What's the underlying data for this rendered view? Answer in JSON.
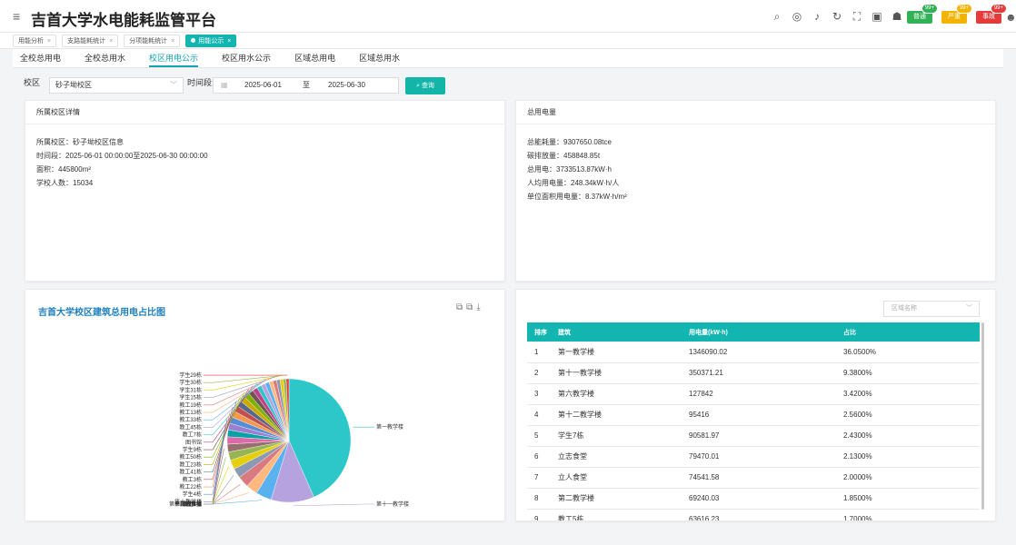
{
  "header": {
    "title": "吉首大学水电能耗监管平台",
    "alarms": [
      {
        "label": "普通",
        "count": "99+",
        "color": "#33b157"
      },
      {
        "label": "严重",
        "count": "99+",
        "color": "#f2b400"
      },
      {
        "label": "事故",
        "count": "99+",
        "color": "#e33b3b"
      }
    ]
  },
  "tabs": [
    {
      "label": "用能分析"
    },
    {
      "label": "支路能耗统计"
    },
    {
      "label": "分项能耗统计"
    },
    {
      "label": "用能公示",
      "active": true
    }
  ],
  "subtabs": [
    {
      "label": "全校总用电"
    },
    {
      "label": "全校总用水"
    },
    {
      "label": "校区用电公示",
      "active": true
    },
    {
      "label": "校区用水公示"
    },
    {
      "label": "区域总用电"
    },
    {
      "label": "区域总用水"
    }
  ],
  "filter": {
    "campus_label": "校区",
    "campus_value": "砂子坳校区",
    "period_label": "时间段:",
    "start_date": "2025-06-01",
    "to_label": "至",
    "end_date": "2025-06-30",
    "query_label": "查询"
  },
  "campus_card": {
    "title": "所属校区详情",
    "lines": [
      "所属校区：砂子坳校区信息",
      "时间段：2025-06-01 00:00:00至2025-06-30 00:00:00",
      "面积：445800m²",
      "学校人数：15034"
    ]
  },
  "total_card": {
    "title": "总用电量",
    "lines": [
      "总能耗量：9307650.08tce",
      "碳排放量：458848.85t",
      "总用电：3733513.87kW·h",
      "人均用电量：248.34kW·h/人",
      "单位面积用电量：8.37kW·h/m²"
    ]
  },
  "chart_data": {
    "type": "pie",
    "title": "吉首大学校区建筑总用电占比图",
    "accent": "#2ec7c9",
    "slices": [
      {
        "name": "第一教学楼",
        "value": 36.05,
        "color": "#2ec7c9"
      },
      {
        "name": "第十一教学楼",
        "value": 9.38,
        "color": "#b6a2de"
      },
      {
        "name": "第六教学楼",
        "value": 3.42,
        "color": "#5ab1ef"
      },
      {
        "name": "第十二教学楼",
        "value": 2.56,
        "color": "#ffb980"
      },
      {
        "name": "学生7栋",
        "value": 2.43,
        "color": "#d87a80"
      },
      {
        "name": "立志食堂",
        "value": 2.13,
        "color": "#8d98b3"
      },
      {
        "name": "立人食堂",
        "value": 2.0,
        "color": "#e5cf0d"
      },
      {
        "name": "第二教学楼",
        "value": 1.85,
        "color": "#97b552"
      },
      {
        "name": "教工4栋",
        "value": 1.7,
        "color": "#95706d"
      },
      {
        "name": "学生1栋",
        "value": 1.6,
        "color": "#dc69aa"
      },
      {
        "name": "教工11栋",
        "value": 1.5,
        "color": "#07a2a4"
      },
      {
        "name": "第十教学楼",
        "value": 1.45,
        "color": "#9a7fd1"
      },
      {
        "name": "学生4栋",
        "value": 1.4,
        "color": "#588dd5"
      },
      {
        "name": "教工22栋",
        "value": 1.35,
        "color": "#f5994e"
      },
      {
        "name": "教工3栋",
        "value": 1.3,
        "color": "#c05050"
      },
      {
        "name": "教工41栋",
        "value": 1.25,
        "color": "#59678c"
      },
      {
        "name": "教工23栋",
        "value": 1.2,
        "color": "#c9ab00"
      },
      {
        "name": "教工50栋",
        "value": 1.15,
        "color": "#7eb00a"
      },
      {
        "name": "学生9栋",
        "value": 1.1,
        "color": "#6f5553"
      },
      {
        "name": "图书馆",
        "value": 1.05,
        "color": "#c14089"
      },
      {
        "name": "教工7栋",
        "value": 1.0,
        "color": "#2ec7c9"
      },
      {
        "name": "教工45栋",
        "value": 0.95,
        "color": "#b6a2de"
      },
      {
        "name": "教工33栋",
        "value": 0.9,
        "color": "#5ab1ef"
      },
      {
        "name": "教工13栋",
        "value": 0.85,
        "color": "#ffb980"
      },
      {
        "name": "教工19栋",
        "value": 0.8,
        "color": "#d87a80"
      },
      {
        "name": "学生15栋",
        "value": 0.75,
        "color": "#8d98b3"
      },
      {
        "name": "学生31栋",
        "value": 0.7,
        "color": "#e5cf0d"
      },
      {
        "name": "学生30栋",
        "value": 0.65,
        "color": "#97b552"
      },
      {
        "name": "学生29栋",
        "value": 0.6,
        "color": "#e33b3b"
      }
    ]
  },
  "ranking": {
    "area_placeholder": "区域名称",
    "columns": [
      "排序",
      "建筑",
      "用电量(kW·h)",
      "占比"
    ],
    "rows": [
      [
        "1",
        "第一教学楼",
        "1346090.02",
        "36.0500%"
      ],
      [
        "2",
        "第十一教学楼",
        "350371.21",
        "9.3800%"
      ],
      [
        "3",
        "第六教学楼",
        "127842",
        "3.4200%"
      ],
      [
        "4",
        "第十二教学楼",
        "95416",
        "2.5600%"
      ],
      [
        "5",
        "学生7栋",
        "90581.97",
        "2.4300%"
      ],
      [
        "6",
        "立志食堂",
        "79470.01",
        "2.1300%"
      ],
      [
        "7",
        "立人食堂",
        "74541.58",
        "2.0000%"
      ],
      [
        "8",
        "第二教学楼",
        "69240.03",
        "1.8500%"
      ],
      [
        "9",
        "教工5栋",
        "63616.23",
        "1.7000%"
      ]
    ]
  }
}
